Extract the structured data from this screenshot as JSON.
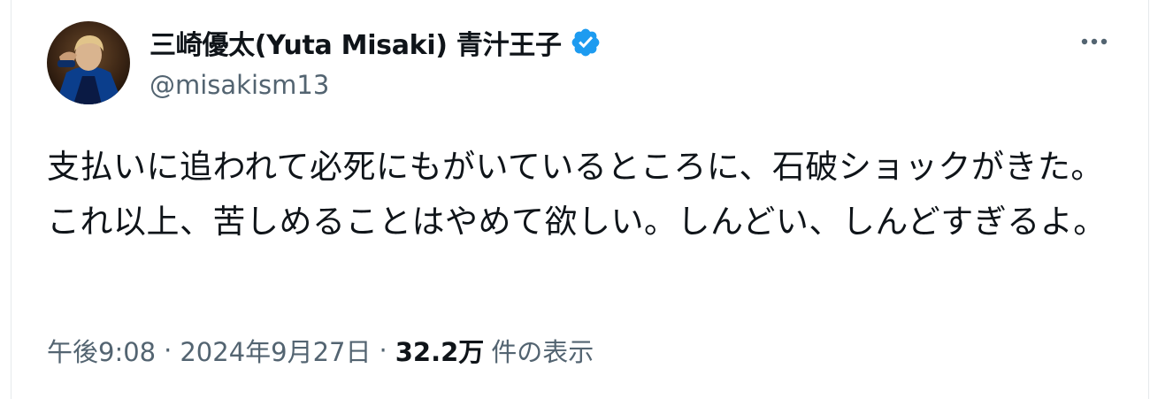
{
  "author": {
    "display_name": "三崎優太(Yuta Misaki) 青汁王子",
    "handle": "@misakism13",
    "verified_icon": "verified-badge-icon",
    "avatar_icon": "profile-photo"
  },
  "tweet": {
    "text": "支払いに追われて必死にもがいているところに、石破ショックがきた。これ以上、苦しめることはやめて欲しい。しんどい、しんどすぎるよ。"
  },
  "meta": {
    "time": "午後9:08",
    "separator": "·",
    "date": "2024年9月27日",
    "views_count": "32.2万",
    "views_label": "件の表示"
  },
  "actions": {
    "more_icon": "more-horizontal-icon"
  },
  "colors": {
    "text": "#0f1419",
    "secondary": "#536471",
    "verified": "#1d9bf0",
    "border": "#e6e9ec"
  }
}
